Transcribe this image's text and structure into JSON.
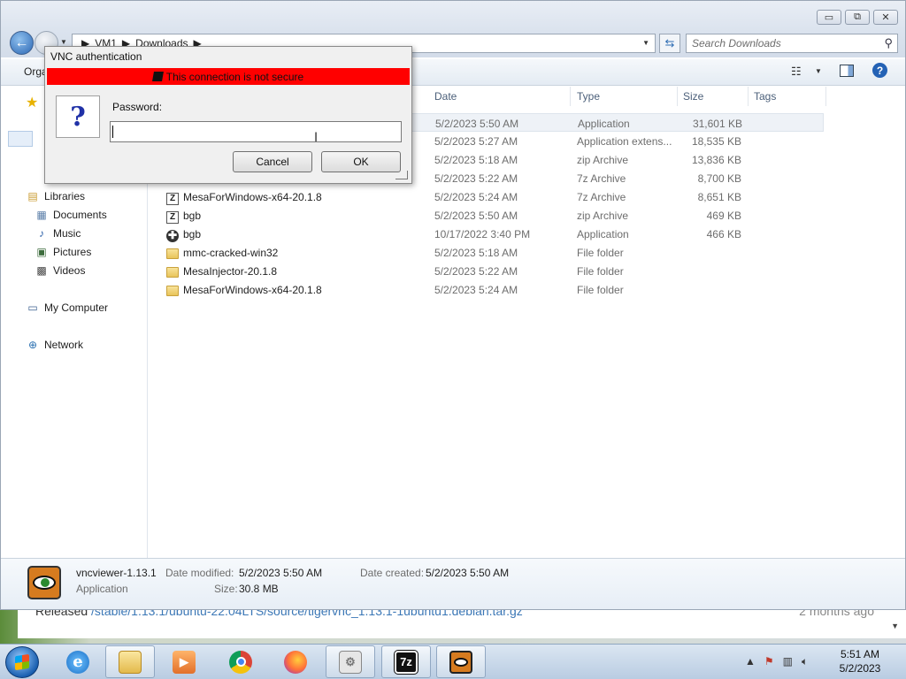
{
  "explorer": {
    "window_buttons": [
      "▭",
      "⧉",
      "✕"
    ],
    "breadcrumbs": [
      "VM1",
      "Downloads"
    ],
    "search": {
      "placeholder": "Search Downloads"
    },
    "toolbar": {
      "organize_label": "Orga"
    },
    "sidebar": {
      "libraries": "Libraries",
      "documents": "Documents",
      "music": "Music",
      "pictures": "Pictures",
      "videos": "Videos",
      "my_computer": "My Computer",
      "network": "Network"
    },
    "columns": {
      "date": "Date",
      "type": "Type",
      "size": "Size",
      "tags": "Tags"
    },
    "files": [
      {
        "name": "",
        "date": "5/2/2023 5:50 AM",
        "type": "Application",
        "size": "31,601 KB",
        "icon": "app-icon",
        "selected": true
      },
      {
        "name": "",
        "date": "5/2/2023 5:27 AM",
        "type": "Application extens...",
        "size": "18,535 KB",
        "icon": "app-icon"
      },
      {
        "name": "",
        "date": "5/2/2023 5:18 AM",
        "type": "zip Archive",
        "size": "13,836 KB",
        "icon": "archive-icon"
      },
      {
        "name": "",
        "date": "5/2/2023 5:22 AM",
        "type": "7z Archive",
        "size": "8,700 KB",
        "icon": "archive-icon"
      },
      {
        "name": "MesaForWindows-x64-20.1.8",
        "date": "5/2/2023 5:24 AM",
        "type": "7z Archive",
        "size": "8,651 KB",
        "icon": "archive-icon"
      },
      {
        "name": "bgb",
        "date": "5/2/2023 5:50 AM",
        "type": "zip Archive",
        "size": "469 KB",
        "icon": "archive-icon"
      },
      {
        "name": "bgb",
        "date": "10/17/2022 3:40 PM",
        "type": "Application",
        "size": "466 KB",
        "icon": "bgb-app-icon"
      },
      {
        "name": "mmc-cracked-win32",
        "date": "5/2/2023 5:18 AM",
        "type": "File folder",
        "size": "",
        "icon": "folder-icon"
      },
      {
        "name": "MesaInjector-20.1.8",
        "date": "5/2/2023 5:22 AM",
        "type": "File folder",
        "size": "",
        "icon": "folder-icon"
      },
      {
        "name": "MesaForWindows-x64-20.1.8",
        "date": "5/2/2023 5:24 AM",
        "type": "File folder",
        "size": "",
        "icon": "folder-icon"
      }
    ],
    "details": {
      "name": "vncviewer-1.13.1",
      "kind": "Application",
      "date_modified_label": "Date modified:",
      "date_modified": "5/2/2023 5:50 AM",
      "size_label": "Size:",
      "size": "30.8 MB",
      "date_created_label": "Date created:",
      "date_created": "5/2/2023 5:50 AM"
    }
  },
  "browser_behind": {
    "released_label": "Released",
    "path": "/stable/1.13.1/ubuntu-22.04LTS/source/tigervnc_1.13.1-1ubuntu1.debian.tar.gz",
    "ago": "2 months ago"
  },
  "vnc_dialog": {
    "title": "VNC authentication",
    "warning": "This connection is not secure",
    "question_glyph": "?",
    "password_label": "Password:",
    "password_value": "",
    "cancel_label": "Cancel",
    "ok_label": "OK"
  },
  "taskbar": {
    "apps": [
      "start",
      "internet-explorer",
      "file-explorer",
      "media-player",
      "chrome",
      "firefox",
      "system-window",
      "7zip",
      "vncviewer"
    ],
    "sevenzip_label": "7z",
    "tray_up_arrow": "▲",
    "clock_time": "5:51 AM",
    "clock_date": "5/2/2023"
  },
  "colors": {
    "warning_red": "#ff0000",
    "accent_blue": "#2462b5",
    "question_blue": "#2031a7"
  }
}
